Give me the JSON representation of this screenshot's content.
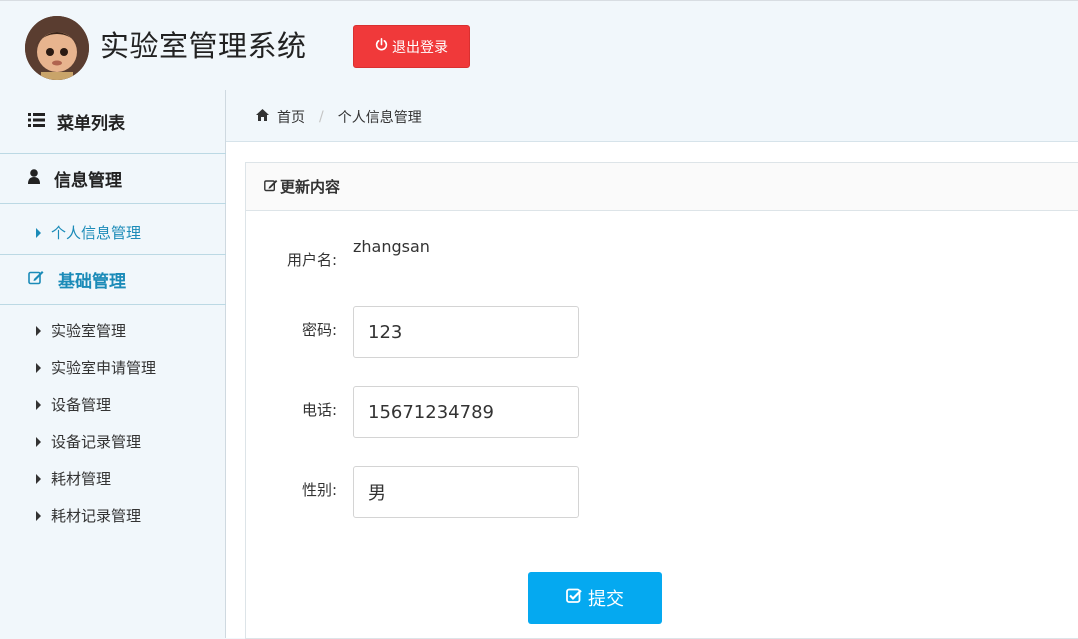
{
  "header": {
    "title": "实验室管理系统",
    "logout_label": "退出登录"
  },
  "sidebar": {
    "menu_title": "菜单列表",
    "groups": [
      {
        "label": "信息管理",
        "items": [
          "个人信息管理"
        ]
      },
      {
        "label": "基础管理",
        "items": [
          "实验室管理",
          "实验室申请管理",
          "设备管理",
          "设备记录管理",
          "耗材管理",
          "耗材记录管理"
        ]
      }
    ],
    "active_item": "个人信息管理"
  },
  "breadcrumb": {
    "home": "首页",
    "current": "个人信息管理"
  },
  "panel": {
    "title": "更新内容",
    "fields": {
      "username_label": "用户名:",
      "username_value": "zhangsan",
      "password_label": "密码:",
      "password_value": "123",
      "phone_label": "电话:",
      "phone_value": "15671234789",
      "gender_label": "性别:",
      "gender_value": "男"
    },
    "submit_label": "提交"
  },
  "colors": {
    "accent": "#1b8bb8",
    "logout": "#f0393a",
    "submit": "#05a9f0"
  }
}
